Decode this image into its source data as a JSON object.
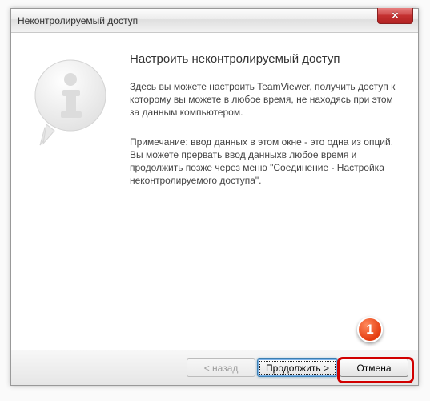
{
  "window": {
    "title": "Неконтролируемый доступ",
    "close_glyph": "✕"
  },
  "body": {
    "heading": "Настроить неконтролируемый доступ",
    "para1": "Здесь вы можете настроить TeamViewer, получить доступ к которому вы можете в любое время, не находясь при этом за данным компьютером.",
    "para2": "Примечание: ввод данных в этом окне  - это одна из опций. Вы можете прервать ввод данныхв любое время и продолжить позже через меню \"Соединение - Настройка неконтролируемого доступа\"."
  },
  "buttons": {
    "back": "< назад",
    "next": "Продолжить >",
    "cancel": "Отмена"
  },
  "callout": {
    "num": "1"
  },
  "colors": {
    "accent_red": "#d10000"
  }
}
